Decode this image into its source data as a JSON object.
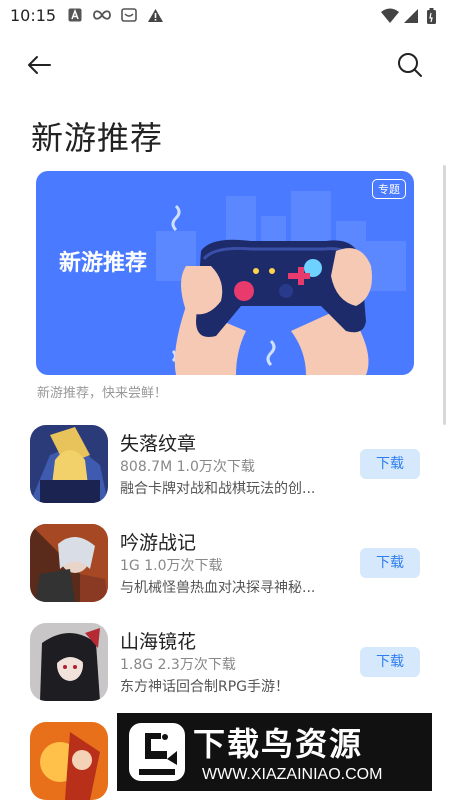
{
  "status_bar": {
    "time": "10:15"
  },
  "title": "新游推荐",
  "banner": {
    "title": "新游推荐",
    "badge": "专题",
    "caption": "新游推荐，快来尝鲜！"
  },
  "apps": [
    {
      "name": "失落纹章",
      "meta": "808.7M  1.0万次下载",
      "desc": "融合卡牌对战和战棋玩法的创...",
      "button": "下载"
    },
    {
      "name": "吟游战记",
      "meta": "1G  1.0万次下载",
      "desc": "与机械怪兽热血对决探寻神秘...",
      "button": "下载"
    },
    {
      "name": "山海镜花",
      "meta": "1.8G  2.3万次下载",
      "desc": "东方神话回合制RPG手游！",
      "button": "下载"
    }
  ],
  "watermark": {
    "title": "下载鸟资源",
    "url": "WWW.XIAZAINIAO.COM"
  },
  "colors": {
    "accent": "#2f7ef0",
    "banner_bg": "#4a7aff",
    "button_bg": "#d6e8fb"
  },
  "icons": [
    "back-arrow-icon",
    "search-icon",
    "wifi-icon",
    "signal-icon",
    "battery-icon"
  ]
}
